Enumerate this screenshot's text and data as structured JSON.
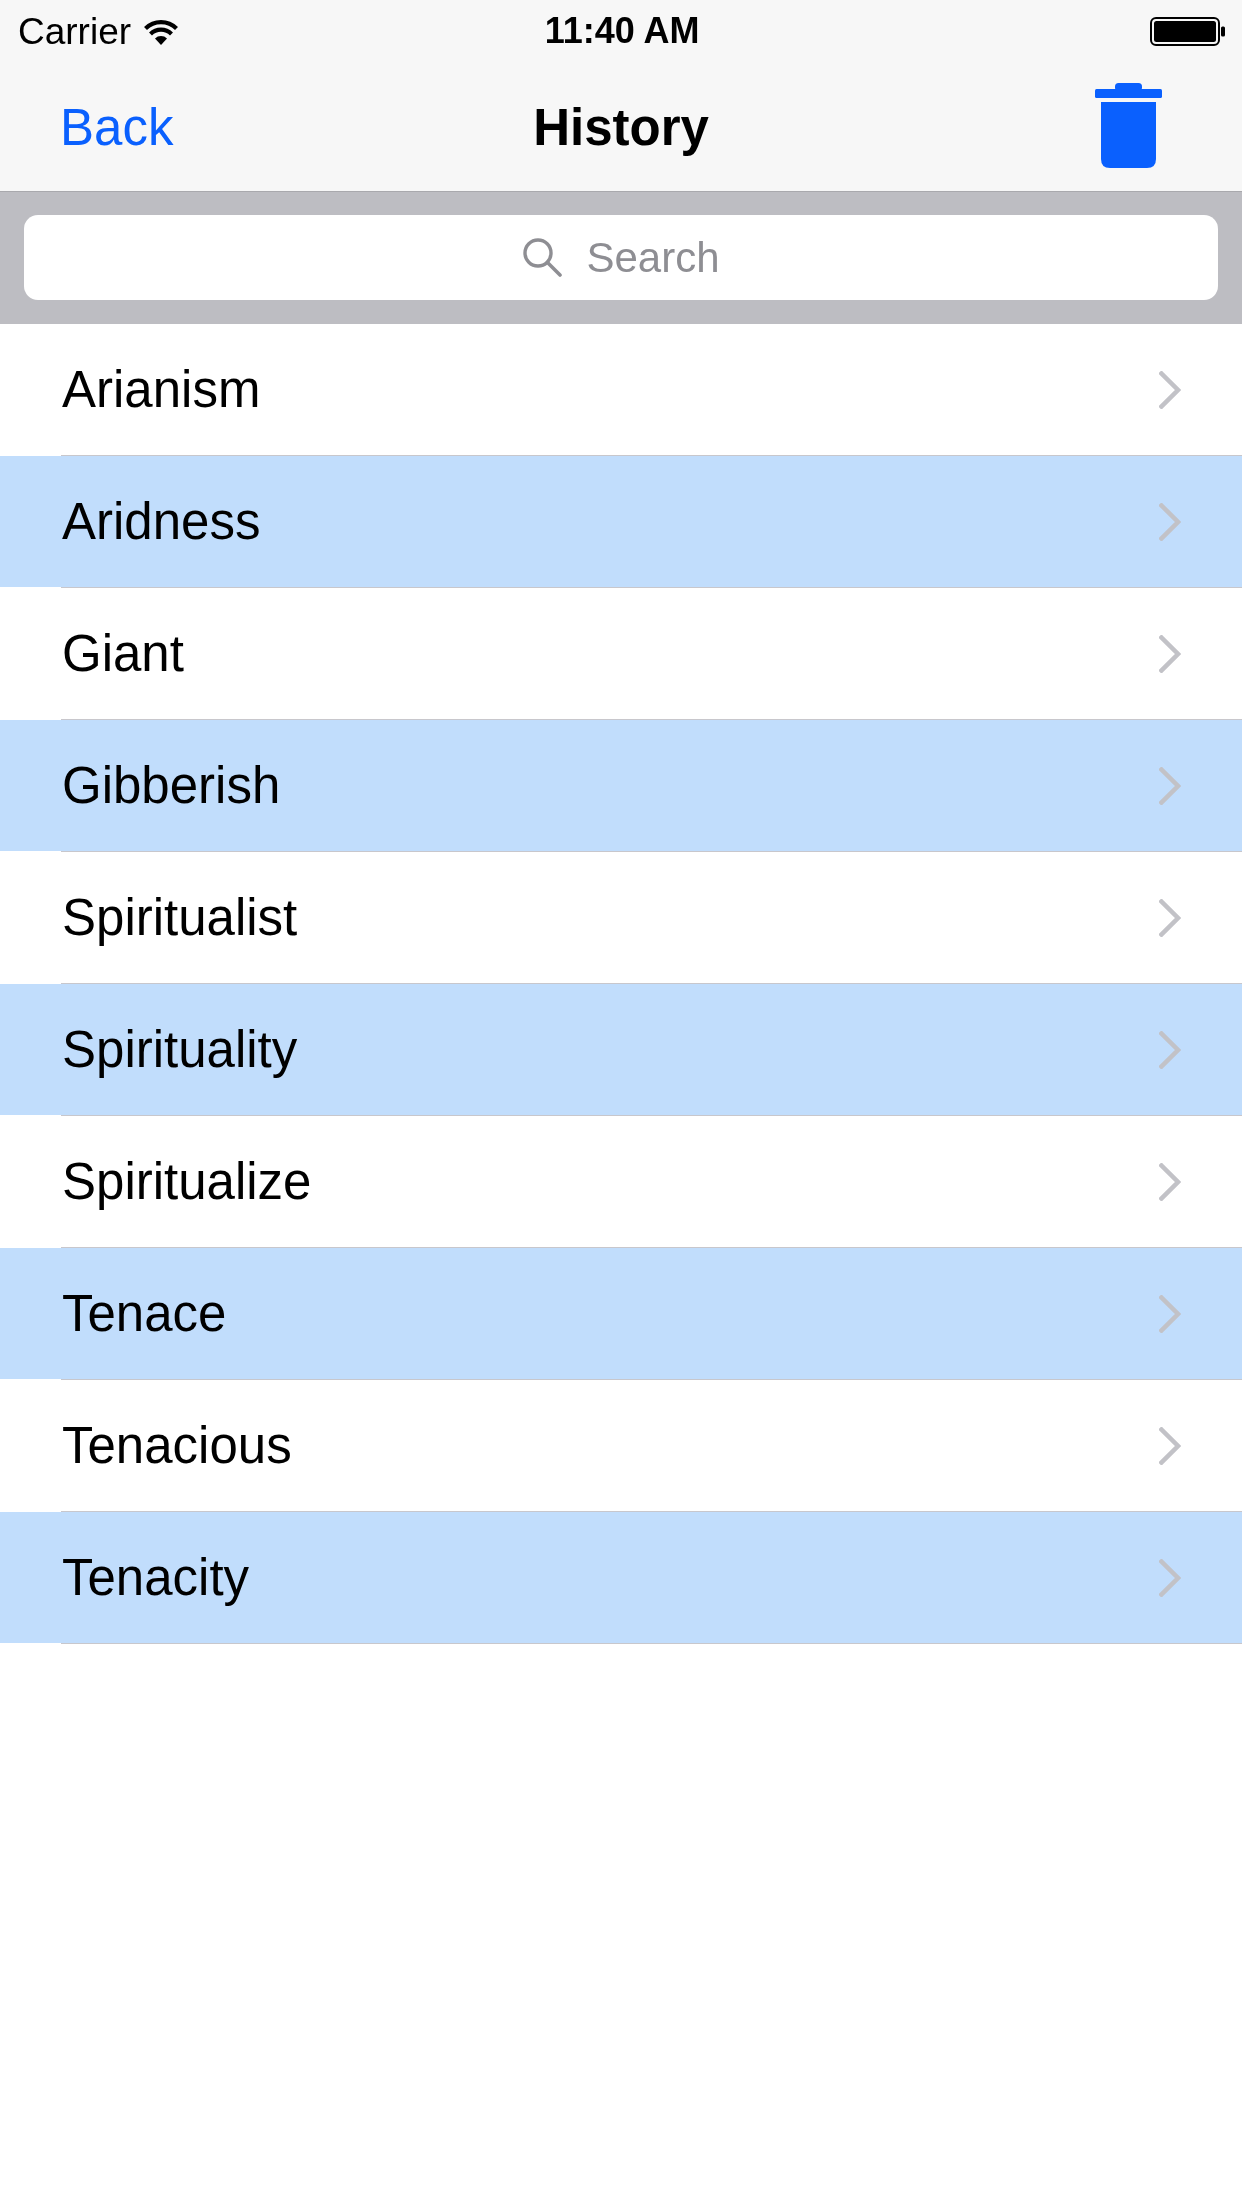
{
  "status_bar": {
    "carrier": "Carrier",
    "time": "11:40 AM"
  },
  "nav_bar": {
    "back_label": "Back",
    "title": "History"
  },
  "search": {
    "placeholder": "Search"
  },
  "list": {
    "items": [
      {
        "label": "Arianism",
        "highlighted": false
      },
      {
        "label": "Aridness",
        "highlighted": true
      },
      {
        "label": "Giant",
        "highlighted": false
      },
      {
        "label": "Gibberish",
        "highlighted": true
      },
      {
        "label": "Spiritualist",
        "highlighted": false
      },
      {
        "label": "Spirituality",
        "highlighted": true
      },
      {
        "label": "Spiritualize",
        "highlighted": false
      },
      {
        "label": "Tenace",
        "highlighted": true
      },
      {
        "label": "Tenacious",
        "highlighted": false
      },
      {
        "label": "Tenacity",
        "highlighted": true
      }
    ]
  }
}
